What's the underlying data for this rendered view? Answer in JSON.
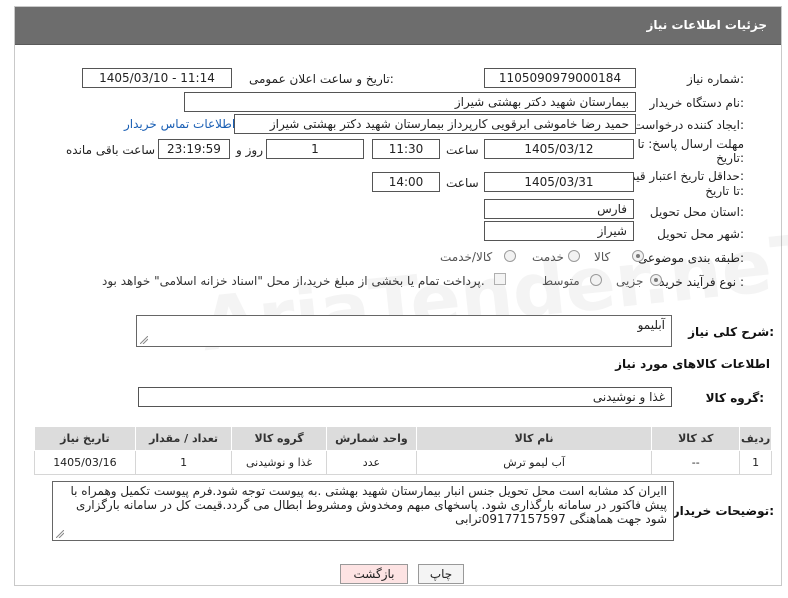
{
  "header": {
    "title": "جزئیات اطلاعات نیاز"
  },
  "fields": {
    "need_number_label": "شماره نیاز:",
    "need_number": "1105090979000184",
    "announce_label": "تاریخ و ساعت اعلان عمومی:",
    "announce_value": "1405/03/10 - 11:14",
    "buyer_org_label": "نام دستگاه خریدار:",
    "buyer_org": "بیمارستان شهید دکتر بهشتی شیراز",
    "creator_label": "ایجاد کننده درخواست:",
    "creator": "حمید رضا خاموشی ابرقویی کارپرداز بیمارستان شهید دکتر بهشتی شیراز",
    "contact_link": "اطلاعات تماس خریدار",
    "deadline_label_1": "مهلت ارسال پاسخ: تا",
    "deadline_label_2": "تاریخ:",
    "deadline_date": "1405/03/12",
    "time_label": "ساعت",
    "deadline_time": "11:30",
    "days_value": "1",
    "days_label": "روز و",
    "remaining_time": "23:19:59",
    "remaining_label": "ساعت باقی مانده",
    "validity_label_1": "حداقل تاریخ اعتبار قیمت:",
    "validity_label_2": "تا تاریخ:",
    "validity_date": "1405/03/31",
    "validity_time_label": "ساعت",
    "validity_time": "14:00",
    "province_label": "استان محل تحویل:",
    "province": "فارس",
    "city_label": "شهر محل تحویل:",
    "city": "شیراز",
    "category_label": "طبقه بندی موضوعی:",
    "category_options": [
      "کالا",
      "خدمت",
      "کالا/خدمت"
    ],
    "process_label": "نوع فرآیند خرید :",
    "process_options": [
      "جزیی",
      "متوسط"
    ],
    "payment_note": "پرداخت تمام یا بخشی از مبلغ خرید،از محل \"اسناد خزانه اسلامی\" خواهد بود.",
    "summary_label": "شرح کلی نیاز:",
    "summary": "آبلیمو",
    "goods_info_title": "اطلاعات کالاهای مورد نیاز",
    "goods_group_label": "گروه کالا:",
    "goods_group": "غذا و نوشیدنی"
  },
  "table": {
    "headers": [
      "ردیف",
      "کد کالا",
      "نام کالا",
      "واحد شمارش",
      "گروه کالا",
      "تعداد / مقدار",
      "تاریخ نیاز"
    ],
    "rows": [
      [
        "1",
        "--",
        "آب لیمو ترش",
        "عدد",
        "غذا و نوشیدنی",
        "1",
        "1405/03/16"
      ]
    ]
  },
  "buyer_notes_label": "توضیحات خریدار:",
  "buyer_notes": "اایران کد مشابه است محل تحویل جنس انبار بیمارستان شهید بهشتی .به پیوست توجه شود.فرم پیوست تکمیل وهمراه با پیش فاکتور در سامانه بارگذاری شود. پاسخهای مبهم ومخدوش ومشروط ابطال می گردد.قیمت کل در سامانه بارگزاری شود جهت هماهنگی 09177157597ترابی",
  "buttons": {
    "print": "چاپ",
    "back": "بازگشت"
  },
  "watermark": "AriaTender.neT",
  "colors": {
    "header_bg": "#6d6d6d",
    "link": "#1a5fb4",
    "back_button_bg": "#fde3e3"
  }
}
